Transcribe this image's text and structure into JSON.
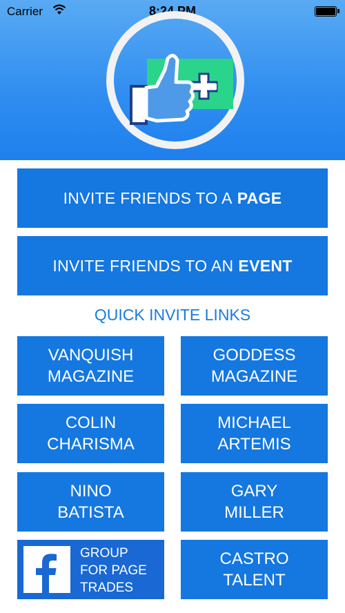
{
  "status_bar": {
    "carrier": "Carrier",
    "time": "8:24 PM"
  },
  "icons": {
    "wifi": "wifi-icon",
    "battery": "battery-icon",
    "logo": "thumbs-up-plus-icon",
    "facebook": "facebook-icon"
  },
  "main": {
    "invite_page_prefix": "INVITE FRIENDS TO A",
    "invite_page_emph": "PAGE",
    "invite_event_prefix": "INVITE FRIENDS TO AN",
    "invite_event_emph": "EVENT",
    "quick_title": "QUICK INVITE LINKS"
  },
  "quick_links": [
    {
      "line1": "VANQUISH",
      "line2": "MAGAZINE"
    },
    {
      "line1": "GODDESS",
      "line2": "MAGAZINE"
    },
    {
      "line1": "COLIN",
      "line2": "CHARISMA"
    },
    {
      "line1": "MICHAEL",
      "line2": "ARTEMIS"
    },
    {
      "line1": "NINO",
      "line2": "BATISTA"
    },
    {
      "line1": "GARY",
      "line2": "MILLER"
    },
    {
      "line1": "GROUP",
      "line2": "FOR PAGE",
      "line3": "TRADES"
    },
    {
      "line1": "CASTRO",
      "line2": "TALENT"
    }
  ],
  "colors": {
    "button_blue": "#1577e0",
    "facebook_blue": "#1968d3",
    "header_blue": "#2f8df0",
    "logo_green": "#2bd48b"
  }
}
